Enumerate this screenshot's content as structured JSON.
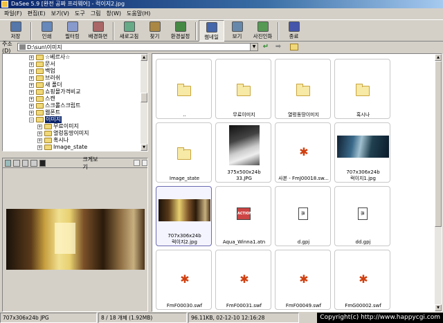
{
  "window": {
    "title": "DaSee 5.9 [완전 공짜 프리웨어] - 럭이지2.jpg"
  },
  "menu": [
    "파일(F)",
    "편집(E)",
    "보기(V)",
    "도구",
    "그림",
    "창(W)",
    "도움말(H)"
  ],
  "toolbar": [
    {
      "name": "save",
      "label": "저장",
      "icon": "floppy-icon",
      "color": "#5577aa"
    },
    {
      "name": "print",
      "label": "인쇄",
      "icon": "printer-icon",
      "color": "#6688bb"
    },
    {
      "name": "filter",
      "label": "필터링",
      "icon": "filter-icon",
      "color": "#8899cc"
    },
    {
      "name": "wallpaper",
      "label": "배경화면",
      "icon": "wallpaper-icon",
      "color": "#aa6666"
    },
    {
      "name": "refresh",
      "label": "새로고침",
      "icon": "refresh-icon",
      "color": "#66aa88"
    },
    {
      "name": "find",
      "label": "찾기",
      "icon": "binoculars-icon",
      "color": "#aa8844"
    },
    {
      "name": "settings",
      "label": "환경설정",
      "icon": "settings-icon",
      "color": "#448844"
    },
    {
      "name": "thumbnail",
      "label": "썸네일",
      "icon": "thumbnail-icon",
      "color": "#4466aa",
      "pressed": true
    },
    {
      "name": "view",
      "label": "보기",
      "icon": "view-icon",
      "color": "#6688aa"
    },
    {
      "name": "photo-print",
      "label": "사진인화",
      "icon": "photo-print-icon",
      "color": "#559955"
    },
    {
      "name": "exit",
      "label": "종료",
      "icon": "exit-icon",
      "color": "#4455aa"
    }
  ],
  "address": {
    "label": "주소(D)",
    "value": "D:\\sun\\이미지"
  },
  "tree": [
    {
      "label": "☆베르사☆",
      "level": 0
    },
    {
      "label": "문서",
      "level": 0
    },
    {
      "label": "백업",
      "level": 0
    },
    {
      "label": "브러쉬",
      "level": 0
    },
    {
      "label": "새 폴더",
      "level": 0
    },
    {
      "label": "쇼핑몰가격비교",
      "level": 0
    },
    {
      "label": "스캔",
      "level": 0
    },
    {
      "label": "스크롤스크립트",
      "level": 0
    },
    {
      "label": "웹폰트",
      "level": 0
    },
    {
      "label": "이미지",
      "level": 0,
      "selected": true,
      "expanded": true
    },
    {
      "label": "무료이미지",
      "level": 1
    },
    {
      "label": "열렁동땅이미지",
      "level": 1
    },
    {
      "label": "혹시나",
      "level": 1
    },
    {
      "label": "Image_state",
      "level": 1
    }
  ],
  "preview": {
    "title": "크게보기"
  },
  "thumbs": [
    {
      "caption": "..",
      "type": "folder"
    },
    {
      "caption": "무료이미지",
      "type": "folder"
    },
    {
      "caption": "열렁동땅이미지",
      "type": "folder"
    },
    {
      "caption": "혹시나",
      "type": "folder"
    },
    {
      "caption": "Image_state",
      "type": "folder"
    },
    {
      "caption": "375x500x24b",
      "caption2": "33.JPG",
      "type": "photo-tall"
    },
    {
      "caption": "사본 - FmJ00018.sw...",
      "type": "flash"
    },
    {
      "caption": "707x306x24b",
      "caption2": "럭이지1.jpg",
      "type": "photo-wide-blue"
    },
    {
      "caption": "707x306x24b",
      "caption2": "럭이지2.jpg",
      "type": "photo-wide-gold",
      "selected": true
    },
    {
      "caption": "Aqua_Winna1.atn",
      "type": "action"
    },
    {
      "caption": "d.gpj",
      "type": "doc"
    },
    {
      "caption": "dd.gpj",
      "type": "doc"
    },
    {
      "caption": "FmF00030.swf",
      "type": "flash"
    },
    {
      "caption": "FmF00031.swf",
      "type": "flash"
    },
    {
      "caption": "FmF00049.swf",
      "type": "flash"
    },
    {
      "caption": "FmG00002.swf",
      "type": "flash"
    }
  ],
  "status": {
    "imginfo": "707x306x24b JPG",
    "count": "8 / 18 개체 (1.92MB)",
    "fileinfo": "96.11KB, 02-12-10 12:16:28"
  },
  "copyright": "Copyright(c) http://www.happycgi.com"
}
